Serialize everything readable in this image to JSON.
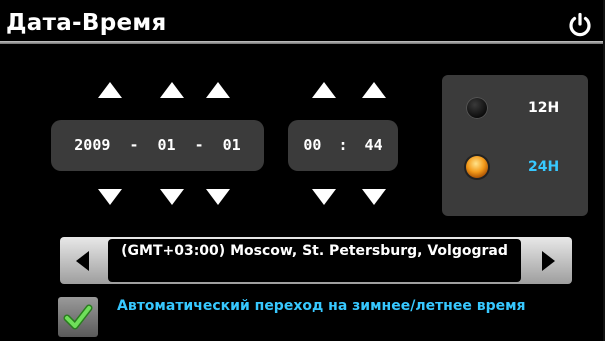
{
  "header": {
    "title": "Дата-Время",
    "power_icon": "power-icon"
  },
  "date": {
    "year": "2009",
    "month": "01",
    "day": "01",
    "separator": "-"
  },
  "time": {
    "hours": "00",
    "minutes": "44",
    "separator": ":"
  },
  "time_format": {
    "options": [
      {
        "label": "12H",
        "selected": false
      },
      {
        "label": "24H",
        "selected": true
      }
    ],
    "selected_color": "#37c8ff"
  },
  "timezone": {
    "value": "(GMT+03:00) Moscow, St. Petersburg, Volgograd"
  },
  "dst": {
    "checked": true,
    "label": "Автоматический переход на зимнее/летнее время"
  },
  "colors": {
    "background": "#000000",
    "accent": "#37c8ff",
    "box": "#3b3b3b"
  }
}
